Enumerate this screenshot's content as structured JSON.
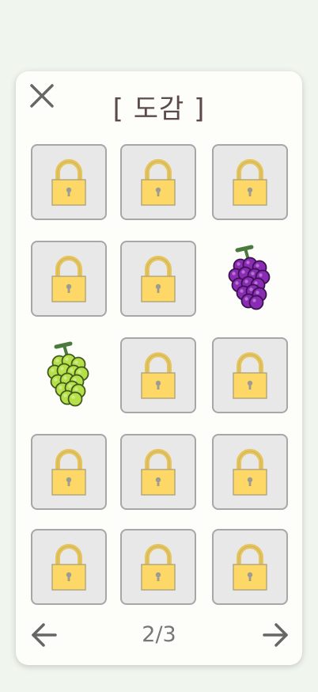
{
  "dex": {
    "title": "[ 도감 ]",
    "page_indicator": "2/3",
    "items": [
      {
        "state": "locked",
        "icon": "lock-icon"
      },
      {
        "state": "locked",
        "icon": "lock-icon"
      },
      {
        "state": "locked",
        "icon": "lock-icon"
      },
      {
        "state": "locked",
        "icon": "lock-icon"
      },
      {
        "state": "locked",
        "icon": "lock-icon"
      },
      {
        "state": "unlocked",
        "icon": "purple-grape-icon"
      },
      {
        "state": "unlocked",
        "icon": "green-grape-icon"
      },
      {
        "state": "locked",
        "icon": "lock-icon"
      },
      {
        "state": "locked",
        "icon": "lock-icon"
      },
      {
        "state": "locked",
        "icon": "lock-icon"
      },
      {
        "state": "locked",
        "icon": "lock-icon"
      },
      {
        "state": "locked",
        "icon": "lock-icon"
      },
      {
        "state": "locked",
        "icon": "lock-icon"
      },
      {
        "state": "locked",
        "icon": "lock-icon"
      },
      {
        "state": "locked",
        "icon": "lock-icon"
      }
    ]
  },
  "icons": {
    "close": "close-icon",
    "prev": "arrow-left-icon",
    "next": "arrow-right-icon"
  },
  "colors": {
    "background": "#f0f5ee",
    "panel": "#fdfdfa",
    "title": "#5b4a48",
    "lock_body": "#fdd866",
    "lock_shackle": "#e7c55a",
    "cell_border": "#a7a7a7",
    "cell_fill": "#e8e8e8",
    "purple_grape": "#8a2ab5",
    "green_grape": "#b6e048"
  }
}
